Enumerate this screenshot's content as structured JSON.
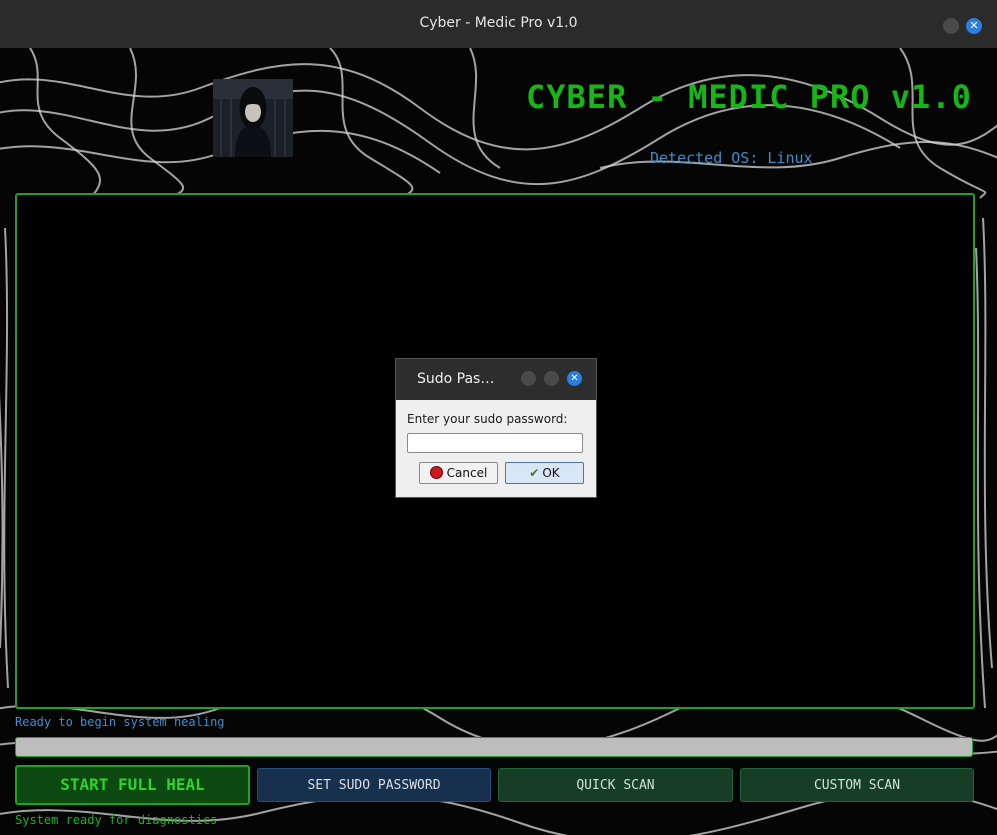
{
  "window": {
    "title": "Cyber - Medic Pro v1.0"
  },
  "header": {
    "app_title": "CYBER - MEDIC PRO v1.0",
    "detected_os": "Detected OS: Linux"
  },
  "status": {
    "top_message": "Ready to begin system healing",
    "bottom_message": "System ready for diagnostics",
    "progress": 0
  },
  "buttons": {
    "start_full_heal": "START FULL HEAL",
    "set_sudo_password": "SET SUDO PASSWORD",
    "quick_scan": "QUICK SCAN",
    "custom_scan": "CUSTOM SCAN"
  },
  "dialog": {
    "title": "Sudo Pas…",
    "prompt": "Enter your sudo password:",
    "password_value": "",
    "cancel_label": "Cancel",
    "ok_label": "OK"
  },
  "colors": {
    "accent_green": "#17b617",
    "info_blue": "#3a8fd0",
    "border_green": "#1fa21f"
  },
  "icons": {
    "window_close": "close-icon",
    "cancel": "cancel-icon",
    "ok": "ok-icon"
  }
}
